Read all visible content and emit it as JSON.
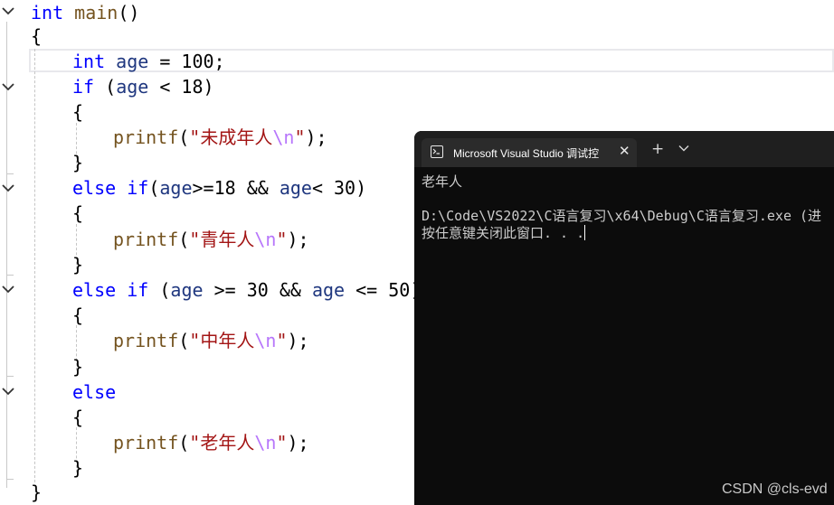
{
  "editor": {
    "lines": [
      {
        "parts": [
          {
            "t": "int",
            "c": "kw"
          },
          {
            "t": " ",
            "c": "op"
          },
          {
            "t": "main",
            "c": "fn"
          },
          {
            "t": "()",
            "c": "op"
          }
        ]
      },
      {
        "parts": [
          {
            "t": "{",
            "c": "op"
          }
        ]
      },
      {
        "parts": [
          {
            "t": "int",
            "c": "kw"
          },
          {
            "t": " ",
            "c": "op"
          },
          {
            "t": "age",
            "c": "var"
          },
          {
            "t": " = 100;",
            "c": "op"
          }
        ]
      },
      {
        "parts": [
          {
            "t": "if",
            "c": "kw"
          },
          {
            "t": " (",
            "c": "op"
          },
          {
            "t": "age",
            "c": "var"
          },
          {
            "t": " < 18)",
            "c": "op"
          }
        ]
      },
      {
        "parts": [
          {
            "t": "{",
            "c": "op"
          }
        ]
      },
      {
        "parts": [
          {
            "t": "printf",
            "c": "fn"
          },
          {
            "t": "(",
            "c": "op"
          },
          {
            "t": "\"未成年人",
            "c": "str"
          },
          {
            "t": "\\n",
            "c": "esc"
          },
          {
            "t": "\"",
            "c": "str"
          },
          {
            "t": ");",
            "c": "op"
          }
        ]
      },
      {
        "parts": [
          {
            "t": "}",
            "c": "op"
          }
        ]
      },
      {
        "parts": [
          {
            "t": "else",
            "c": "kw"
          },
          {
            "t": " ",
            "c": "op"
          },
          {
            "t": "if",
            "c": "kw"
          },
          {
            "t": "(",
            "c": "op"
          },
          {
            "t": "age",
            "c": "var"
          },
          {
            "t": ">=18 && ",
            "c": "op"
          },
          {
            "t": "age",
            "c": "var"
          },
          {
            "t": "< 30)",
            "c": "op"
          }
        ]
      },
      {
        "parts": [
          {
            "t": "{",
            "c": "op"
          }
        ]
      },
      {
        "parts": [
          {
            "t": "printf",
            "c": "fn"
          },
          {
            "t": "(",
            "c": "op"
          },
          {
            "t": "\"青年人",
            "c": "str"
          },
          {
            "t": "\\n",
            "c": "esc"
          },
          {
            "t": "\"",
            "c": "str"
          },
          {
            "t": ");",
            "c": "op"
          }
        ]
      },
      {
        "parts": [
          {
            "t": "}",
            "c": "op"
          }
        ]
      },
      {
        "parts": [
          {
            "t": "else",
            "c": "kw"
          },
          {
            "t": " ",
            "c": "op"
          },
          {
            "t": "if",
            "c": "kw"
          },
          {
            "t": " (",
            "c": "op"
          },
          {
            "t": "age",
            "c": "var"
          },
          {
            "t": " >= 30 && ",
            "c": "op"
          },
          {
            "t": "age",
            "c": "var"
          },
          {
            "t": " <= 50)",
            "c": "op"
          }
        ]
      },
      {
        "parts": [
          {
            "t": "{",
            "c": "op"
          }
        ]
      },
      {
        "parts": [
          {
            "t": "printf",
            "c": "fn"
          },
          {
            "t": "(",
            "c": "op"
          },
          {
            "t": "\"中年人",
            "c": "str"
          },
          {
            "t": "\\n",
            "c": "esc"
          },
          {
            "t": "\"",
            "c": "str"
          },
          {
            "t": ");",
            "c": "op"
          }
        ]
      },
      {
        "parts": [
          {
            "t": "}",
            "c": "op"
          }
        ]
      },
      {
        "parts": [
          {
            "t": "else",
            "c": "kw"
          }
        ]
      },
      {
        "parts": [
          {
            "t": "{",
            "c": "op"
          }
        ]
      },
      {
        "parts": [
          {
            "t": "printf",
            "c": "fn"
          },
          {
            "t": "(",
            "c": "op"
          },
          {
            "t": "\"老年人",
            "c": "str"
          },
          {
            "t": "\\n",
            "c": "esc"
          },
          {
            "t": "\"",
            "c": "str"
          },
          {
            "t": ");",
            "c": "op"
          }
        ]
      },
      {
        "parts": [
          {
            "t": "}",
            "c": "op"
          }
        ]
      },
      {
        "parts": [
          {
            "t": "}",
            "c": "op"
          }
        ]
      }
    ],
    "fold_icon": "chevron-down-icon"
  },
  "terminal": {
    "tab_icon": "console-icon",
    "tab_title": "Microsoft Visual Studio 调试控",
    "close_glyph": "✕",
    "add_glyph": "+",
    "dropdown_icon": "chevron-down-icon",
    "output_line_1": "老年人",
    "output_line_2": "",
    "output_line_3": "D:\\Code\\VS2022\\C语言复习\\x64\\Debug\\C语言复习.exe (进",
    "output_line_4": "按任意键关闭此窗口. . ."
  },
  "watermark": "CSDN @cls-evd",
  "colors": {
    "keyword": "#0000ff",
    "function": "#74531f",
    "variable": "#1f377f",
    "string": "#a31515",
    "escape": "#b776fb",
    "terminal_bg": "#0c0c0c"
  }
}
